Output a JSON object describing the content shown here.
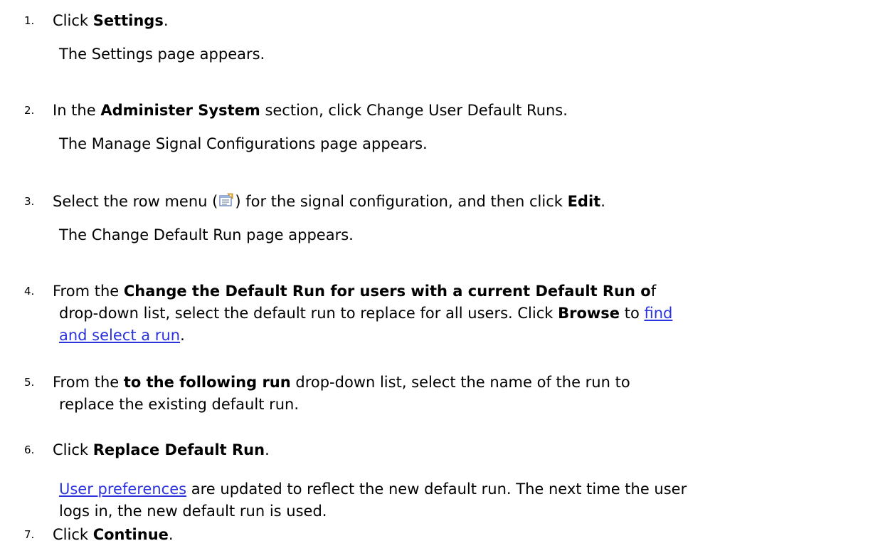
{
  "steps": [
    {
      "num": "1.",
      "pre": "Click ",
      "bold": "Settings",
      "post": ".",
      "result": "The Settings page appears."
    },
    {
      "num": "2.",
      "pre": "In the ",
      "bold": "Administer System",
      "post": " section, click Change User Default Runs.",
      "result": "The Manage Signal Configurations page appears."
    },
    {
      "num": "3.",
      "pre": "Select the row menu (",
      "icon": "row-menu-icon",
      "mid": ") for the signal configuration, and then click ",
      "bold": "Edit",
      "post": ".",
      "result": "The Change Default Run page appears."
    },
    {
      "num": "4.",
      "pre": "From the ",
      "bold": "Change the Default Run for users with a current Default Run o",
      "post": "f",
      "line2_pre": "drop-down list, select the default run to replace for all users. Click ",
      "line2_bold": "Browse",
      "line2_mid": " to ",
      "link_part1": "find",
      "link_part2": "and select a run",
      "line3_post": "."
    },
    {
      "num": "5.",
      "pre": "From the ",
      "bold": "to the following run",
      "post": " drop-down list, select the name of the run to",
      "line2": "replace the existing default run."
    },
    {
      "num": "6.",
      "pre": "Click ",
      "bold": "Replace Default Run",
      "post": ".",
      "result_link": "User preferences",
      "result_post": " are updated to reflect the new default run. The next time the user",
      "result_line2": "logs in, the new default run is used."
    },
    {
      "num": "7.",
      "pre": "Click ",
      "bold": "Continue",
      "post": "."
    }
  ]
}
